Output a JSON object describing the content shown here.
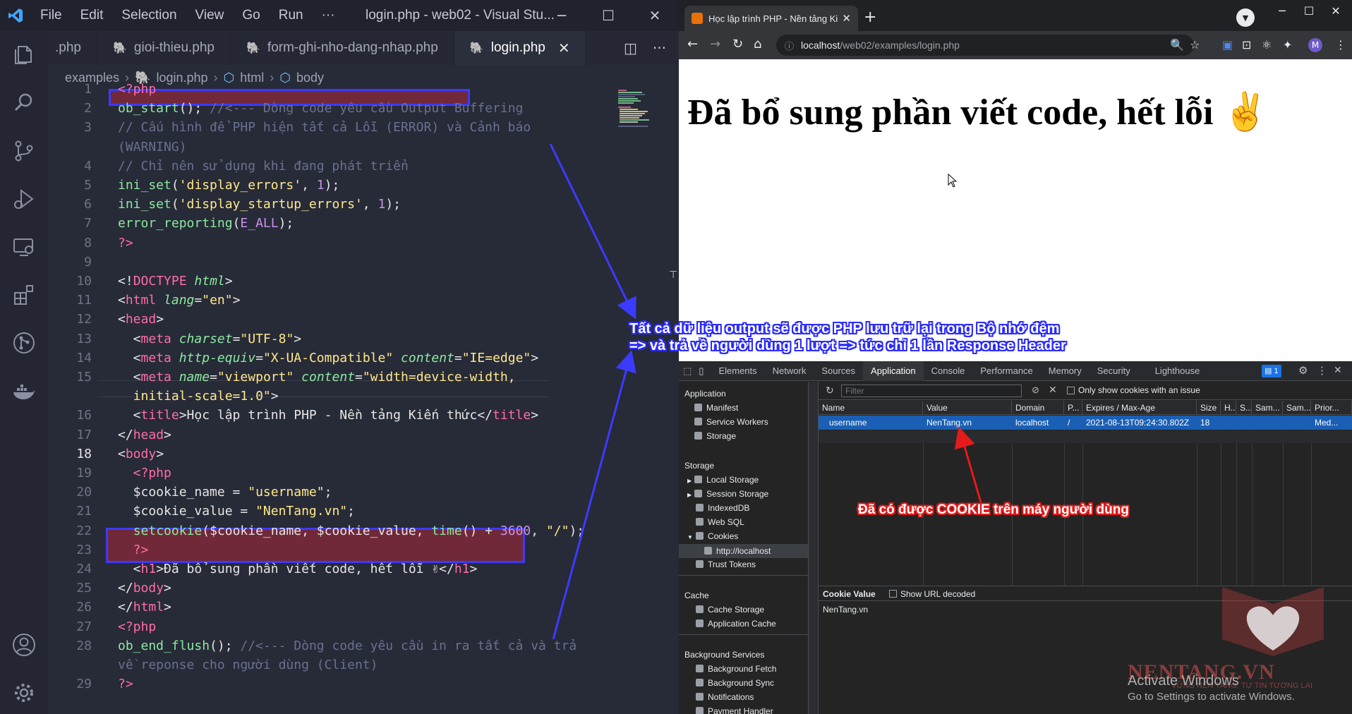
{
  "vscode": {
    "menu": [
      "File",
      "Edit",
      "Selection",
      "View",
      "Go",
      "Run",
      "···"
    ],
    "window_title": "login.php - web02 - Visual Stu...",
    "tabs": [
      {
        "label": ".php"
      },
      {
        "label": "gioi-thieu.php"
      },
      {
        "label": "form-ghi-nho-dang-nhap.php"
      },
      {
        "label": "login.php",
        "active": true
      }
    ],
    "breadcrumb": [
      "examples",
      "login.php",
      "html",
      "body"
    ],
    "line_numbers": [
      "1",
      "2",
      "3",
      "",
      "4",
      "5",
      "6",
      "7",
      "8",
      "9",
      "10",
      "11",
      "12",
      "13",
      "14",
      "15",
      "",
      "16",
      "17",
      "18",
      "19",
      "20",
      "21",
      "22",
      "23",
      "24",
      "25",
      "26",
      "27",
      "28",
      "",
      "29"
    ],
    "current_line": "18"
  },
  "chrome": {
    "tab_title": "Học lập trình PHP - Nền tảng Kiế",
    "url_host": "localhost",
    "url_path": "/web02/examples/login.php",
    "avatar_letter": "M",
    "page_heading": "Đã bổ sung phần viết code, hết lỗi ✌"
  },
  "devtools": {
    "tabs": [
      "Elements",
      "Network",
      "Sources",
      "Application",
      "Console",
      "Performance",
      "Memory",
      "Security",
      "Lighthouse"
    ],
    "active_tab": "Application",
    "badge": "1",
    "sidebar": {
      "application_title": "Application",
      "application_items": [
        "Manifest",
        "Service Workers",
        "Storage"
      ],
      "storage_title": "Storage",
      "storage_items": [
        "Local Storage",
        "Session Storage",
        "IndexedDB",
        "Web SQL",
        "Cookies",
        "http://localhost",
        "Trust Tokens"
      ],
      "cache_title": "Cache",
      "cache_items": [
        "Cache Storage",
        "Application Cache"
      ],
      "bg_title": "Background Services",
      "bg_items": [
        "Background Fetch",
        "Background Sync",
        "Notifications",
        "Payment Handler"
      ]
    },
    "filter_placeholder": "Filter",
    "only_issue_label": "Only show cookies with an issue",
    "columns": [
      "Name",
      "Value",
      "Domain",
      "P...",
      "Expires / Max-Age",
      "Size",
      "H...",
      "S...",
      "Sam...",
      "Sam...",
      "Prior..."
    ],
    "cookie_row": [
      "username",
      "NenTang.vn",
      "localhost",
      "/",
      "2021-08-13T09:24:30.802Z",
      "18",
      "",
      "",
      "",
      "",
      "Med..."
    ],
    "cookie_value_label": "Cookie Value",
    "show_url_decoded": "Show URL decoded",
    "cookie_value": "NenTang.vn"
  },
  "annotations": {
    "blue_line1": "Tất cả dữ liệu output sẽ được PHP lưu trữ lại trong Bộ nhớ đệm",
    "blue_line2": "=> và trả về người dùng 1 lượt => tức chỉ 1 lần Response Header",
    "red": "Đã có được COOKIE trên máy người dùng"
  },
  "watermark": {
    "brand": "NENTANG.VN",
    "tagline": "VỮNG NỀN TẢNG, TỰ TIN TƯƠNG LAI",
    "activate_title": "Activate Windows",
    "activate_sub": "Go to Settings to activate Windows."
  },
  "colors": {
    "vscode_bg": "#272a37",
    "highlight_box": "#3b3bff",
    "annotation_blue": "#2b2bff",
    "annotation_red": "#e51a1a",
    "devtools_selected_row": "#1a5fb4"
  }
}
